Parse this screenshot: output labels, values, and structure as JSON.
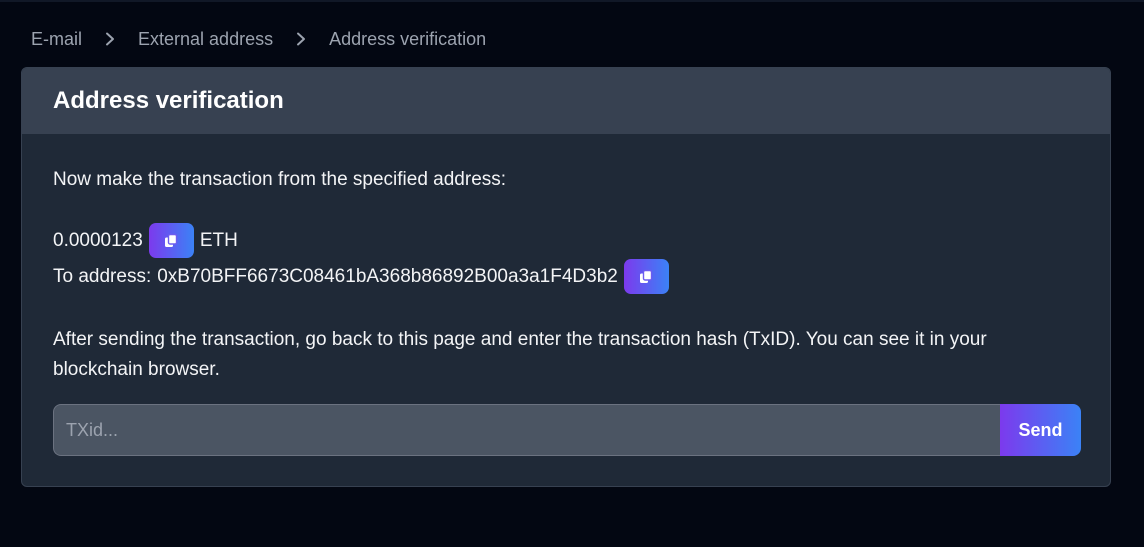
{
  "breadcrumb": {
    "items": [
      {
        "label": "E-mail"
      },
      {
        "label": "External address"
      },
      {
        "label": "Address verification"
      }
    ]
  },
  "card": {
    "title": "Address verification",
    "intro": "Now make the transaction from the specified address:",
    "amount": "0.0000123",
    "currency": "ETH",
    "to_address_label": "To address:",
    "to_address": "0xB70BFF6673C08461bA368b86892B00a3a1F4D3b2",
    "instructions": "After sending the transaction, go back to this page and enter the transaction hash (TxID). You can see it in your blockchain browser.",
    "txid_placeholder": "TXid...",
    "txid_value": "",
    "send_label": "Send"
  },
  "icons": {
    "breadcrumb_separator": "chevron-right-icon",
    "copy": "copy-icon"
  },
  "colors": {
    "background": "#030712",
    "card": "#1f2937",
    "card_header": "#374151",
    "accent_start": "#7c3aed",
    "accent_end": "#3b82f6"
  }
}
